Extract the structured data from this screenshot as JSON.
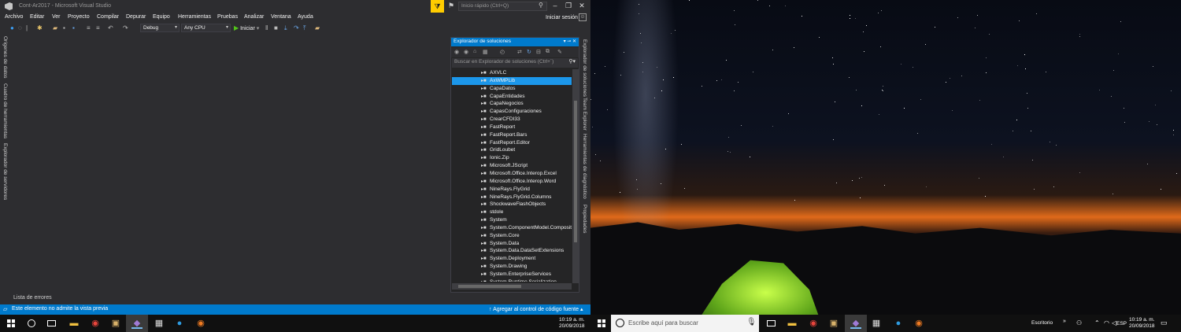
{
  "vs": {
    "window_title": "Cont-Ar2017 - Microsoft Visual Studio",
    "quick_launch_placeholder": "Inicio rápido (Ctrl+Q)",
    "signin": "Iniciar sesión",
    "menu": [
      "Archivo",
      "Editar",
      "Ver",
      "Proyecto",
      "Compilar",
      "Depurar",
      "Equipo",
      "Herramientas",
      "Pruebas",
      "Analizar",
      "Ventana",
      "Ayuda"
    ],
    "toolbar": {
      "config": "Debug",
      "platform": "Any CPU",
      "start_label": "Iniciar"
    },
    "left_tabs": [
      "Orígenes de datos",
      "Cuadro de herramientas",
      "Explorador de servidores"
    ],
    "right_tabs": [
      "Explorador de soluciones",
      "Team Explorer",
      "Herramientas de diagnóstico",
      "Propiedades"
    ],
    "errors_tab": "Lista de errores",
    "solution_explorer": {
      "title": "Explorador de soluciones",
      "search_placeholder": "Buscar en Explorador de soluciones (Ctrl+`)",
      "selected_index": 1,
      "references": [
        "AXVLC",
        "AxWMPLib",
        "CapaDatos",
        "CapaEntidades",
        "CapaNegocios",
        "CapasConfiguraciones",
        "CrearCFDI33",
        "FastReport",
        "FastReport.Bars",
        "FastReport.Editor",
        "GridLoubet",
        "Ionic.Zip",
        "Microsoft.JScript",
        "Microsoft.Office.Interop.Excel",
        "Microsoft.Office.Interop.Word",
        "NineRays.FlyGrid",
        "NineRays.FlyGrid.Columns",
        "ShockwaveFlashObjects",
        "stdole",
        "System",
        "System.ComponentModel.Composition",
        "System.Core",
        "System.Data",
        "System.Data.DataSetExtensions",
        "System.Deployment",
        "System.Drawing",
        "System.EnterpriseServices",
        "System.Runtime.Serialization"
      ]
    },
    "status": {
      "message": "Este elemento no admite la vista previa",
      "source_control": "Agregar al control de código fuente"
    }
  },
  "taskbar_left": {
    "time": "10:19 a. m.",
    "date": "20/09/2018"
  },
  "taskbar_right": {
    "search_placeholder": "Escribe aquí para buscar",
    "desktop_label": "Escritorio",
    "language": "ESP",
    "time": "10:19 a. m.",
    "date": "20/09/2018"
  },
  "colors": {
    "vs_accent": "#007acc",
    "filter_yellow": "#ffcc00",
    "selection": "#1c97ea"
  }
}
